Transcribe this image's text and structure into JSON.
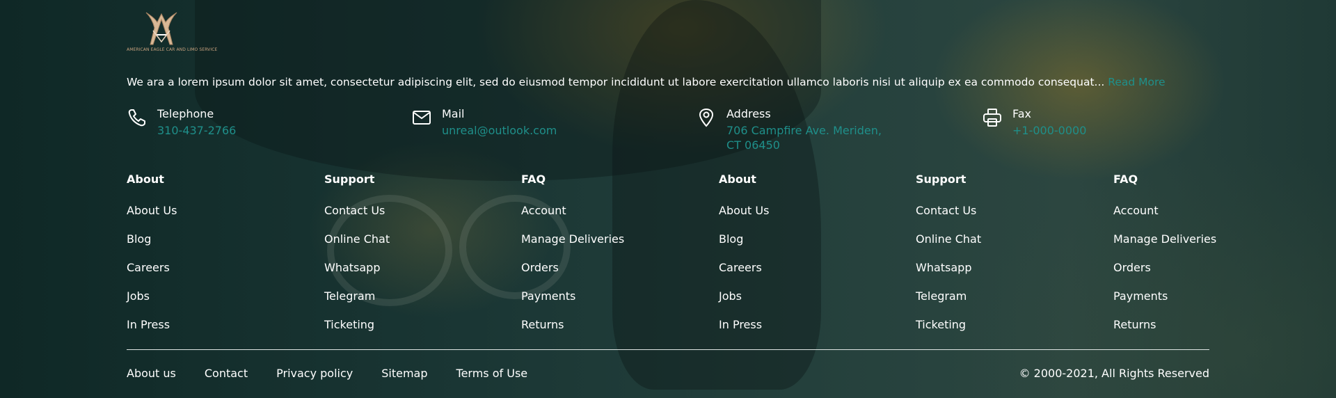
{
  "brand": {
    "logo_text": "AMERICAN EAGLE CAR AND LIMO SERVICE"
  },
  "intro": {
    "text": "We ara a lorem ipsum dolor sit amet, consectetur adipiscing elit, sed do eiusmod tempor incididunt ut labore exercitation ullamco laboris nisi ut aliquip ex ea commodo consequat...",
    "read_more": "Read More"
  },
  "contacts": [
    {
      "icon": "phone-icon",
      "label": "Telephone",
      "value": "310-437-2766"
    },
    {
      "icon": "mail-icon",
      "label": "Mail",
      "value": "unreal@outlook.com"
    },
    {
      "icon": "location-pin-icon",
      "label": "Address",
      "value": "706 Campfire Ave. Meriden, CT 06450"
    },
    {
      "icon": "printer-icon",
      "label": "Fax",
      "value": "+1-000-0000"
    }
  ],
  "columns": [
    {
      "heading": "About",
      "links": [
        "About Us",
        "Blog",
        "Careers",
        "Jobs",
        "In Press"
      ]
    },
    {
      "heading": "Support",
      "links": [
        "Contact Us",
        "Online Chat",
        "Whatsapp",
        "Telegram",
        "Ticketing"
      ]
    },
    {
      "heading": "FAQ",
      "links": [
        "Account",
        "Manage Deliveries",
        "Orders",
        "Payments",
        "Returns"
      ]
    },
    {
      "heading": "About",
      "links": [
        "About Us",
        "Blog",
        "Careers",
        "Jobs",
        "In Press"
      ]
    },
    {
      "heading": "Support",
      "links": [
        "Contact Us",
        "Online Chat",
        "Whatsapp",
        "Telegram",
        "Ticketing"
      ]
    },
    {
      "heading": "FAQ",
      "links": [
        "Account",
        "Manage Deliveries",
        "Orders",
        "Payments",
        "Returns"
      ]
    }
  ],
  "bottom_links": [
    "About us",
    "Contact",
    "Privacy policy",
    "Sitemap",
    "Terms of Use"
  ],
  "copyright": "© 2000-2021, All Rights Reserved",
  "colors": {
    "accent": "#1f8f8a",
    "text": "#ffffff",
    "background": "#1a3634",
    "logo": "#c9a27f"
  }
}
